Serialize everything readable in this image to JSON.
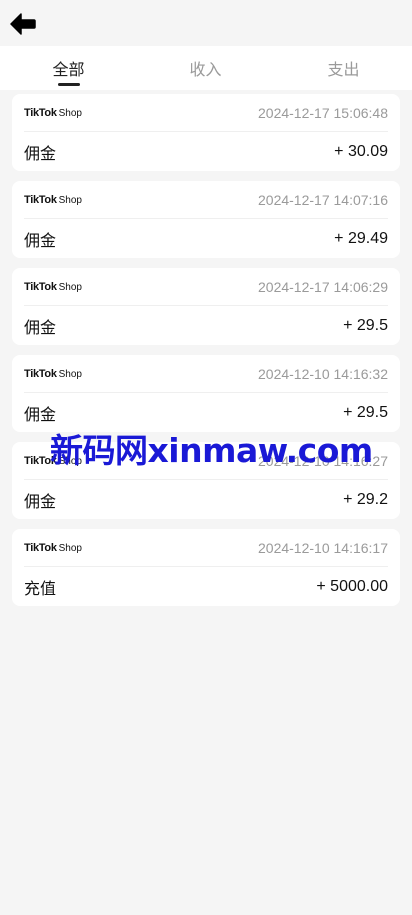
{
  "header": {
    "back_icon": "arrow-left-icon"
  },
  "tabs": [
    {
      "label": "全部",
      "active": true
    },
    {
      "label": "收入",
      "active": false
    },
    {
      "label": "支出",
      "active": false
    }
  ],
  "records": [
    {
      "brand_main": "TikTok",
      "brand_sub": "Shop",
      "time": "2024-12-17 15:06:48",
      "type": "佣金",
      "amount": "+ 30.09"
    },
    {
      "brand_main": "TikTok",
      "brand_sub": "Shop",
      "time": "2024-12-17 14:07:16",
      "type": "佣金",
      "amount": "+ 29.49"
    },
    {
      "brand_main": "TikTok",
      "brand_sub": "Shop",
      "time": "2024-12-17 14:06:29",
      "type": "佣金",
      "amount": "+ 29.5"
    },
    {
      "brand_main": "TikTok",
      "brand_sub": "Shop",
      "time": "2024-12-10 14:16:32",
      "type": "佣金",
      "amount": "+ 29.5"
    },
    {
      "brand_main": "TikTok",
      "brand_sub": "Shop",
      "time": "2024-12-10 14:16:27",
      "type": "佣金",
      "amount": "+ 29.2"
    },
    {
      "brand_main": "TikTok",
      "brand_sub": "Shop",
      "time": "2024-12-10 14:16:17",
      "type": "充值",
      "amount": "+ 5000.00"
    }
  ],
  "watermark": "新码网xinmaw.com",
  "colors": {
    "background": "#f5f5f5",
    "card": "#ffffff",
    "muted_text": "#9a9a9a",
    "watermark": "#1a19d6"
  }
}
